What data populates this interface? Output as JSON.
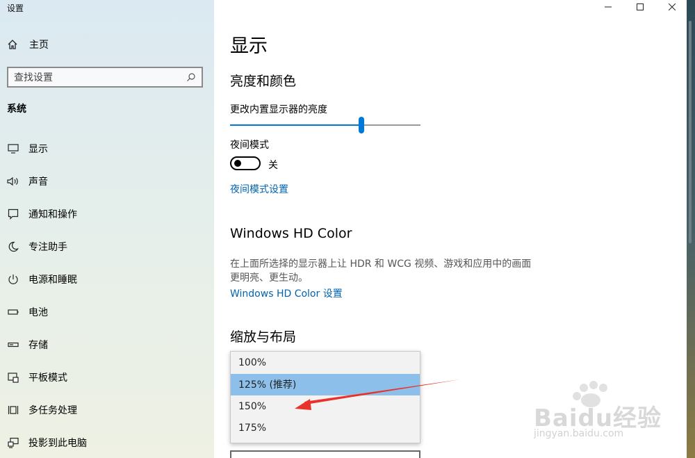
{
  "app": {
    "title": "设置"
  },
  "sidebar": {
    "home_label": "主页",
    "search_placeholder": "查找设置",
    "section": "系统",
    "items": [
      {
        "label": "显示",
        "icon": "monitor-icon"
      },
      {
        "label": "声音",
        "icon": "speaker-icon"
      },
      {
        "label": "通知和操作",
        "icon": "notification-icon"
      },
      {
        "label": "专注助手",
        "icon": "moon-icon"
      },
      {
        "label": "电源和睡眠",
        "icon": "power-icon"
      },
      {
        "label": "电池",
        "icon": "battery-icon"
      },
      {
        "label": "存储",
        "icon": "storage-icon"
      },
      {
        "label": "平板模式",
        "icon": "tablet-icon"
      },
      {
        "label": "多任务处理",
        "icon": "multitask-icon"
      },
      {
        "label": "投影到此电脑",
        "icon": "project-icon"
      }
    ]
  },
  "main": {
    "title": "显示",
    "brightness": {
      "heading": "亮度和颜色",
      "slider_label": "更改内置显示器的亮度",
      "slider_value": 0.69,
      "night_mode_label": "夜间模式",
      "night_mode_state": "关",
      "night_mode_link": "夜间模式设置"
    },
    "hdr": {
      "heading": "Windows HD Color",
      "description": "在上面所选择的显示器上让 HDR 和 WCG 视频、游戏和应用中的画面更明亮、更生动。",
      "link": "Windows HD Color 设置"
    },
    "scale": {
      "heading": "缩放与布局",
      "options": [
        "100%",
        "125% (推荐)",
        "150%",
        "175%"
      ],
      "selected_index": 1
    }
  },
  "watermark": {
    "text": "Baidu经验",
    "sub": "jingyan.baidu.com"
  },
  "colors": {
    "accent": "#0078d7",
    "link": "#0063b1",
    "selected": "#8cc0ea",
    "arrow": "#e8322b"
  }
}
